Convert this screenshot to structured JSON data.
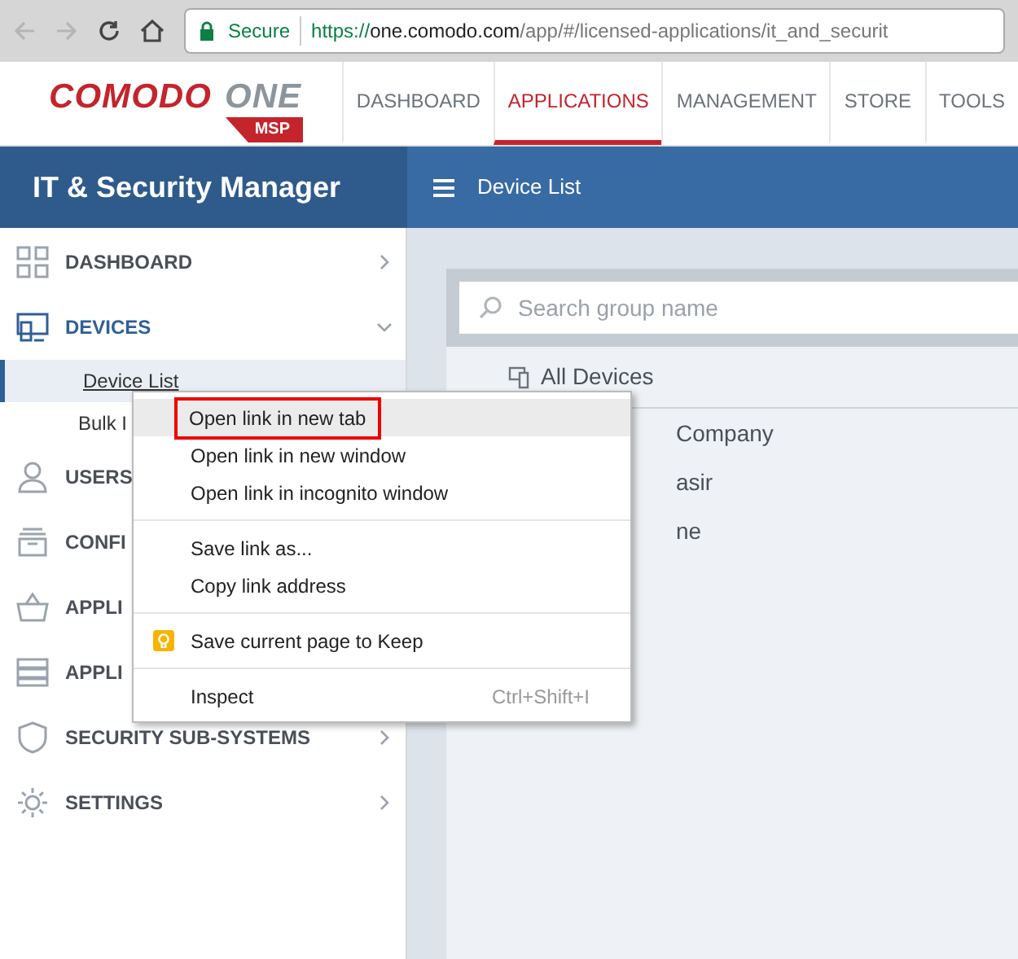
{
  "browser": {
    "secure_label": "Secure",
    "url_scheme": "https://",
    "url_host": "one.comodo.com",
    "url_path": "/app/#/licensed-applications/it_and_securit"
  },
  "logo": {
    "word": "COMODO",
    "mark": "ONE",
    "badge": "MSP"
  },
  "nav_tabs": [
    {
      "label": "DASHBOARD",
      "selected": false
    },
    {
      "label": "APPLICATIONS",
      "selected": true
    },
    {
      "label": "MANAGEMENT",
      "selected": false
    },
    {
      "label": "STORE",
      "selected": false
    },
    {
      "label": "TOOLS",
      "selected": false
    }
  ],
  "app_title": "IT & Security Manager",
  "page_title": "Device List",
  "sidebar": {
    "items": [
      {
        "label": "DASHBOARD",
        "expanded": false
      },
      {
        "label": "DEVICES",
        "expanded": true,
        "children": [
          {
            "label": "Device List",
            "selected": true
          },
          {
            "label": "Bulk I",
            "selected": false
          }
        ]
      },
      {
        "label": "USERS"
      },
      {
        "label": "CONFI"
      },
      {
        "label": "APPLI"
      },
      {
        "label": "APPLI"
      },
      {
        "label": "SECURITY SUB-SYSTEMS",
        "expanded": false
      },
      {
        "label": "SETTINGS",
        "expanded": false
      }
    ]
  },
  "groups": {
    "search": {
      "placeholder": "Search group name"
    },
    "root": "All Devices",
    "items": [
      "Company",
      "asir",
      "ne"
    ]
  },
  "context_menu": {
    "sections": [
      [
        {
          "label": "Open link in new tab",
          "selected": true
        },
        {
          "label": "Open link in new window",
          "selected": false
        },
        {
          "label": "Open link in incognito window",
          "selected": false
        }
      ],
      [
        {
          "label": "Save link as...",
          "selected": false
        },
        {
          "label": "Copy link address",
          "selected": false
        }
      ],
      [
        {
          "label": "Save current page to Keep",
          "selected": false,
          "kind": "keep"
        }
      ],
      [
        {
          "label": "Inspect",
          "selected": false,
          "shortcut": "Ctrl+Shift+I"
        }
      ]
    ]
  }
}
